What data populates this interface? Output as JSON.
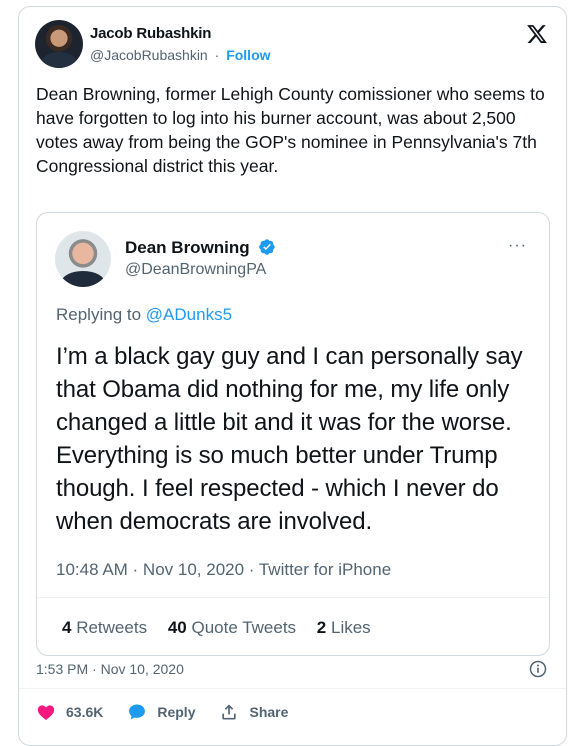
{
  "tweet": {
    "author_name": "Jacob Rubashkin",
    "author_handle": "@JacobRubashkin",
    "separator": "·",
    "follow_label": "Follow",
    "text": "Dean Browning, former Lehigh County comissioner who seems to have forgotten to log into his burner account, was about 2,500 votes away from being the GOP's nominee in Pennsylvania's 7th Congressional district this year.",
    "meta": "1:53 PM · Nov 10, 2020",
    "actions": {
      "likes": "63.6K",
      "reply_label": "Reply",
      "share_label": "Share"
    }
  },
  "quoted": {
    "author_name": "Dean Browning",
    "author_handle": "@DeanBrowningPA",
    "more_label": "···",
    "replying_prefix": "Replying to",
    "replying_mention": "@ADunks5",
    "text": "I’m a black gay guy and I can personally say that Obama did nothing for me, my life only changed a little bit and it was for the worse. Everything is so much better under Trump though. I feel respected - which I never do when democrats are involved.",
    "meta": "10:48 AM · Nov 10, 2020 · Twitter for iPhone",
    "stats": [
      {
        "count": "4",
        "label": "Retweets"
      },
      {
        "count": "40",
        "label": "Quote Tweets"
      },
      {
        "count": "2",
        "label": "Likes"
      }
    ]
  },
  "colors": {
    "accent": "#1d9bf0",
    "like": "#f91880",
    "text": "#0f1419",
    "muted": "#536471"
  },
  "icons": [
    "x-logo-icon",
    "verified-badge-icon",
    "more-icon",
    "info-icon",
    "heart-icon",
    "reply-icon",
    "share-icon"
  ]
}
